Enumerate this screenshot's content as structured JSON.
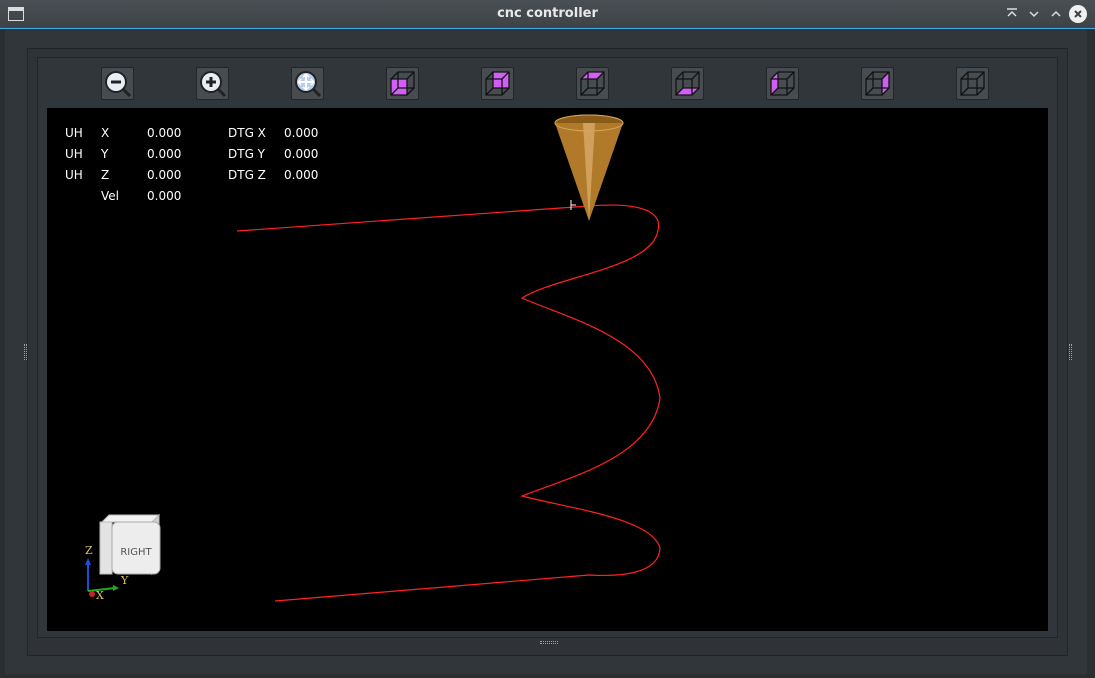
{
  "window": {
    "title": "cnc controller"
  },
  "toolbar": {
    "buttons": [
      {
        "name": "zoom-out-button",
        "icon": "zoom-out-icon"
      },
      {
        "name": "zoom-in-button",
        "icon": "zoom-in-icon"
      },
      {
        "name": "zoom-fit-button",
        "icon": "zoom-fit-icon"
      },
      {
        "name": "view-front-button",
        "icon": "cube-front-icon"
      },
      {
        "name": "view-back-button",
        "icon": "cube-back-icon"
      },
      {
        "name": "view-top-button",
        "icon": "cube-top-icon"
      },
      {
        "name": "view-bottom-button",
        "icon": "cube-bottom-icon"
      },
      {
        "name": "view-left-button",
        "icon": "cube-left-icon"
      },
      {
        "name": "view-right-button",
        "icon": "cube-right-icon"
      },
      {
        "name": "view-iso-button",
        "icon": "cube-iso-icon"
      }
    ]
  },
  "dro": {
    "rows": [
      {
        "prefix": "UH",
        "axis": "X",
        "value": "0.000",
        "dtg_label": "DTG X",
        "dtg_value": "0.000"
      },
      {
        "prefix": "UH",
        "axis": "Y",
        "value": "0.000",
        "dtg_label": "DTG Y",
        "dtg_value": "0.000"
      },
      {
        "prefix": "UH",
        "axis": "Z",
        "value": "0.000",
        "dtg_label": "DTG Z",
        "dtg_value": "0.000"
      }
    ],
    "vel_label": "Vel",
    "vel_value": "0.000"
  },
  "view_cube": {
    "face_label": "RIGHT"
  },
  "axis_triad": {
    "z": "Z",
    "y": "Y",
    "x": "X"
  },
  "colors": {
    "toolpath": "#ff2222",
    "accent": "#3daee9",
    "highlight_face": "#d15ef5",
    "tool": "#b07a2a"
  }
}
